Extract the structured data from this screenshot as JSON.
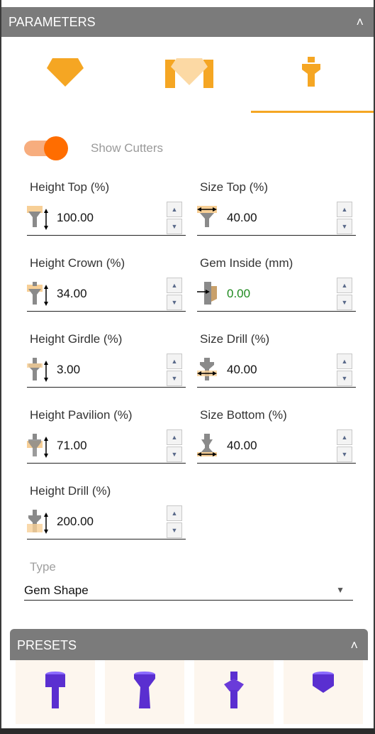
{
  "header": {
    "title": "PARAMETERS"
  },
  "tabs": [
    {
      "name": "gem-tab",
      "icon": "gem-icon"
    },
    {
      "name": "setting-tab",
      "icon": "setting-icon"
    },
    {
      "name": "cutter-tab",
      "icon": "cutter-icon",
      "active": true
    }
  ],
  "toggle": {
    "label": "Show Cutters",
    "on": true
  },
  "fields": {
    "height_top": {
      "label": "Height Top (%)",
      "value": "100.00"
    },
    "size_top": {
      "label": "Size Top (%)",
      "value": "40.00"
    },
    "height_crown": {
      "label": "Height Crown (%)",
      "value": "34.00"
    },
    "gem_inside": {
      "label": "Gem Inside (mm)",
      "value": "0.00"
    },
    "height_girdle": {
      "label": "Height Girdle (%)",
      "value": "3.00"
    },
    "size_drill": {
      "label": "Size Drill (%)",
      "value": "40.00"
    },
    "height_pavilion": {
      "label": "Height Pavilion (%)",
      "value": "71.00"
    },
    "size_bottom": {
      "label": "Size Bottom (%)",
      "value": "40.00"
    },
    "height_drill": {
      "label": "Height Drill (%)",
      "value": "200.00"
    }
  },
  "type": {
    "label": "Type",
    "value": "Gem Shape"
  },
  "presets": {
    "title": "PRESETS"
  },
  "colors": {
    "accent": "#f5a623",
    "toggle": "#ff6d00",
    "preset_shape": "#6a3bd9",
    "header": "#7b7b7b"
  }
}
